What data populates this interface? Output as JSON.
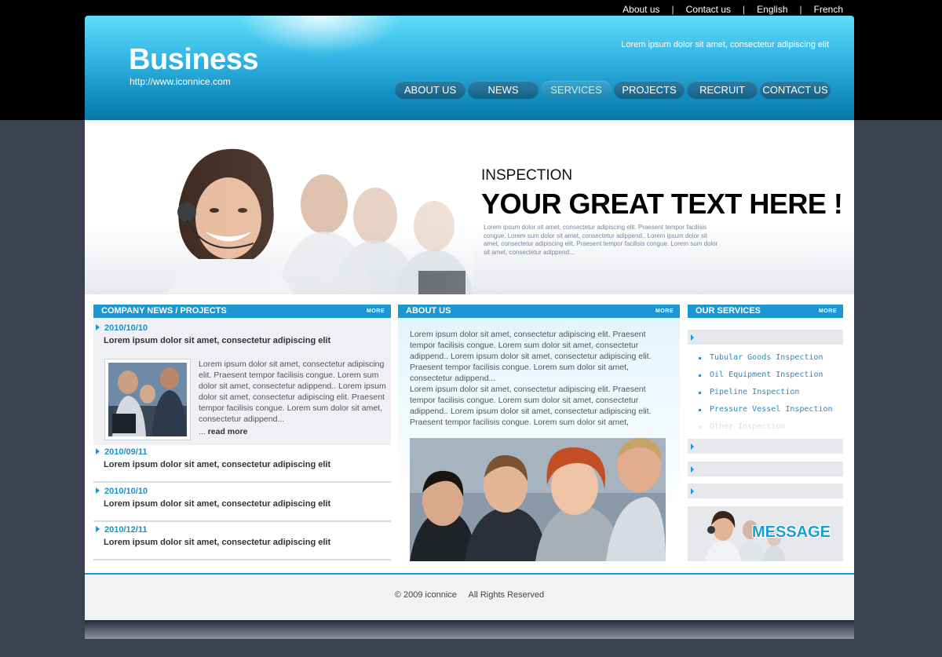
{
  "top_links": [
    "About us",
    "Contact us",
    "English",
    "French"
  ],
  "header": {
    "logo": "Business",
    "url": "http://www.iconnice.com",
    "slogan": "Lorem ipsum dolor sit amet, consectetur adipiscing elit"
  },
  "nav": {
    "items": [
      "ABOUT US",
      "NEWS",
      "SERVICES",
      "PROJECTS",
      "RECRUIT",
      "CONTACT US"
    ],
    "active": "SERVICES"
  },
  "banner": {
    "subtitle": "INSPECTION",
    "title": "YOUR GREAT TEXT HERE !",
    "text": "Lorem ipsum dolor sit amet, consectetur adipiscing elit. Praesent tempor facilisis congue. Lorem sum dolor sit amet, consectetur adippend.. Lorem ipsum dolor sit amet, consectetur adipiscing elit. Praesent tempor facilisis congue. Lorem sum dolor sit amet, consectetur adippend..."
  },
  "news": {
    "header": "COMPANY NEWS  /  PROJECTS",
    "more": "MORE",
    "featured": {
      "date": "2010/10/10",
      "title": "Lorem ipsum dolor sit amet, consectetur adipiscing elit",
      "body": "Lorem ipsum dolor sit amet, consectetur adipiscing elit. Praesent tempor facilisis congue. Lorem sum dolor sit amet, consectetur adippend.. Lorem ipsum dolor sit amet, consectetur adipiscing elit. Praesent tempor facilisis congue. Lorem sum dolor sit amet, consectetur adippend...",
      "ellipsis": "...",
      "read_more": "read more"
    },
    "items": [
      {
        "date": "2010/09/11",
        "title": "Lorem ipsum dolor sit amet, consectetur adipiscing elit"
      },
      {
        "date": "2010/10/10",
        "title": "Lorem ipsum dolor sit amet, consectetur adipiscing elit"
      },
      {
        "date": "2010/12/11",
        "title": "Lorem ipsum dolor sit amet, consectetur adipiscing elit"
      }
    ]
  },
  "about": {
    "header": "ABOUT US",
    "more": "MORE",
    "text": "Lorem ipsum dolor sit amet, consectetur adipiscing elit. Praesent tempor facilisis congue. Lorem sum dolor sit amet, consectetur adippend.. Lorem ipsum dolor sit amet, consectetur adipiscing elit. Praesent tempor facilisis congue. Lorem sum dolor sit amet, consectetur adippend...\nLorem ipsum dolor sit amet, consectetur adipiscing elit. Praesent tempor facilisis congue. Lorem sum dolor sit amet, consectetur adippend.. Lorem ipsum dolor sit amet, consectetur adipiscing elit. Praesent tempor facilisis congue. Lorem sum dolor sit amet,"
  },
  "services": {
    "header": "OUR SERVICES",
    "more": "MORE",
    "items": [
      "Tubular Goods Inspection",
      "Oil Equipment Inspection",
      "Pipeline Inspection",
      "Pressure Vessel Inspection",
      "Other Inspection"
    ],
    "message": "MESSAGE"
  },
  "footer": {
    "copyright": "© 2009 iconnice     All Rights Reserved"
  },
  "colors": {
    "accent": "#1b97d3",
    "header_top": "#5fdcfa",
    "header_bottom": "#0b79aa",
    "page_bg": "#3a4150"
  }
}
